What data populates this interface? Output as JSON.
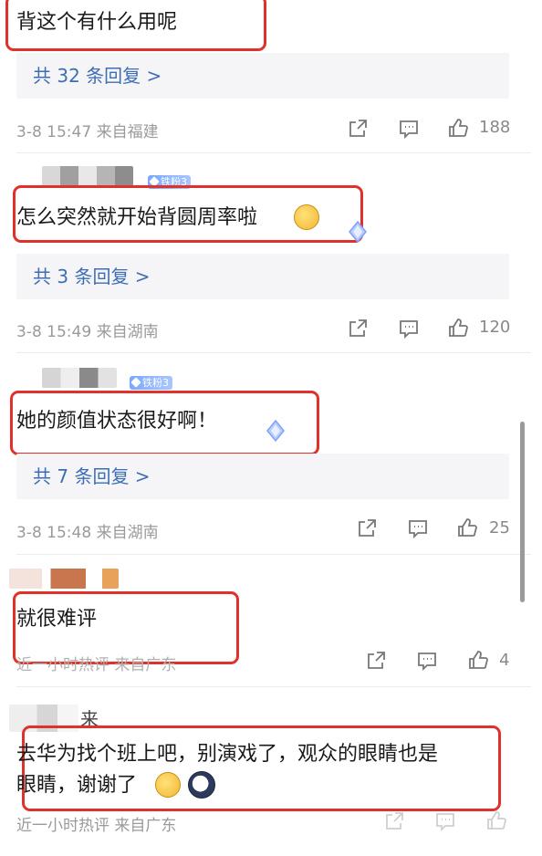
{
  "comments": [
    {
      "text": "背这个有什么用呢",
      "replies": "共 32 条回复 >",
      "meta": "3-8 15:47  来自福建",
      "likes": "188"
    },
    {
      "badge": "铁粉3",
      "text": "怎么突然就开始背圆周率啦",
      "replies": "共 3 条回复 >",
      "meta": "3-8 15:49  来自湖南",
      "likes": "120"
    },
    {
      "badge": "铁粉3",
      "text": "她的颜值状态很好啊！",
      "replies": "共 7 条回复 >",
      "meta": "3-8 15:48  来自湖南",
      "likes": "25"
    },
    {
      "text": "就很难评",
      "meta": "近一小时热评  来自广东",
      "likes": "4"
    },
    {
      "username_partial": "来",
      "text_line1": "去华为找个班上吧，别演戏了，观众的眼睛也是",
      "text_line2": "眼睛，谢谢了",
      "meta": "近一小时热评  来自广东"
    }
  ],
  "colors": {
    "highlight_border": "#e0322a",
    "reply_link": "#3d6eb5",
    "meta_gray": "#9a9a9a",
    "reply_bg": "#f5f5f7"
  },
  "icons": [
    "share-icon",
    "comment-icon",
    "thumbs-up-icon"
  ]
}
